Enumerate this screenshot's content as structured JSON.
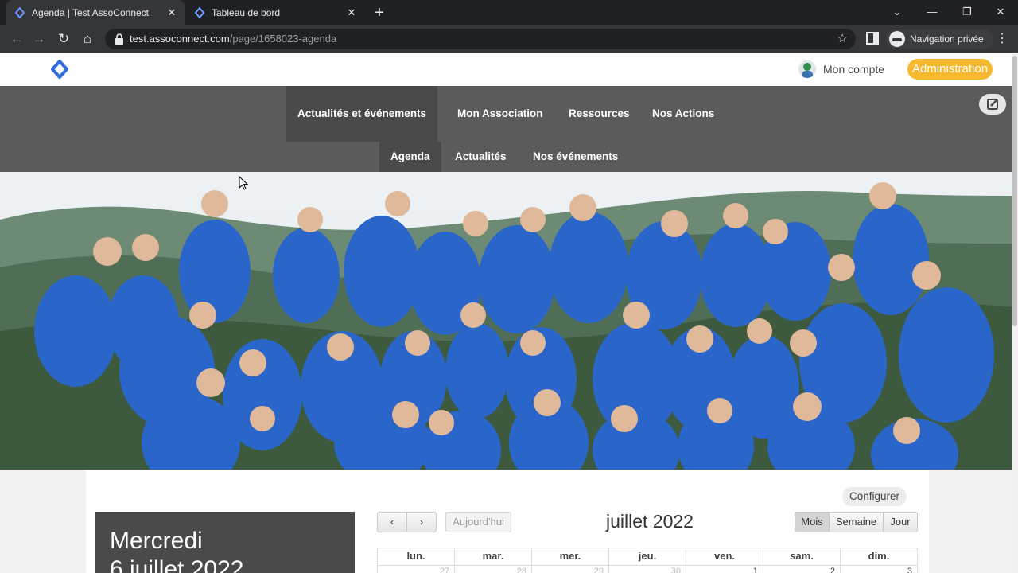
{
  "browser": {
    "tabs": [
      {
        "title": "Agenda | Test AssoConnect",
        "active": true
      },
      {
        "title": "Tableau de bord",
        "active": false
      }
    ],
    "url_host": "test.assoconnect.com",
    "url_path": "/page/1658023-agenda",
    "profile_label": "Navigation privée"
  },
  "header": {
    "account_label": "Mon compte",
    "admin_label": "Administration"
  },
  "nav": {
    "items": [
      {
        "label": "Actualités et événements"
      },
      {
        "label": "Mon Association"
      },
      {
        "label": "Ressources"
      },
      {
        "label": "Nos Actions"
      }
    ],
    "subitems": [
      {
        "label": "Agenda"
      },
      {
        "label": "Actualités"
      },
      {
        "label": "Nos événements"
      }
    ]
  },
  "calendar": {
    "configure_label": "Configurer",
    "selected_day": "Mercredi",
    "selected_date": "6 juillet 2022",
    "today_label": "Aujourd'hui",
    "title": "juillet 2022",
    "views": {
      "month": "Mois",
      "week": "Semaine",
      "day": "Jour"
    },
    "weekdays": [
      "lun.",
      "mar.",
      "mer.",
      "jeu.",
      "ven.",
      "sam.",
      "dim."
    ],
    "first_row": [
      "27",
      "28",
      "29",
      "30",
      "1",
      "2",
      "3"
    ]
  },
  "colors": {
    "accent": "#f5b82e",
    "menu_bg": "#5b5b5b",
    "brand_blue": "#2f6fe0"
  }
}
